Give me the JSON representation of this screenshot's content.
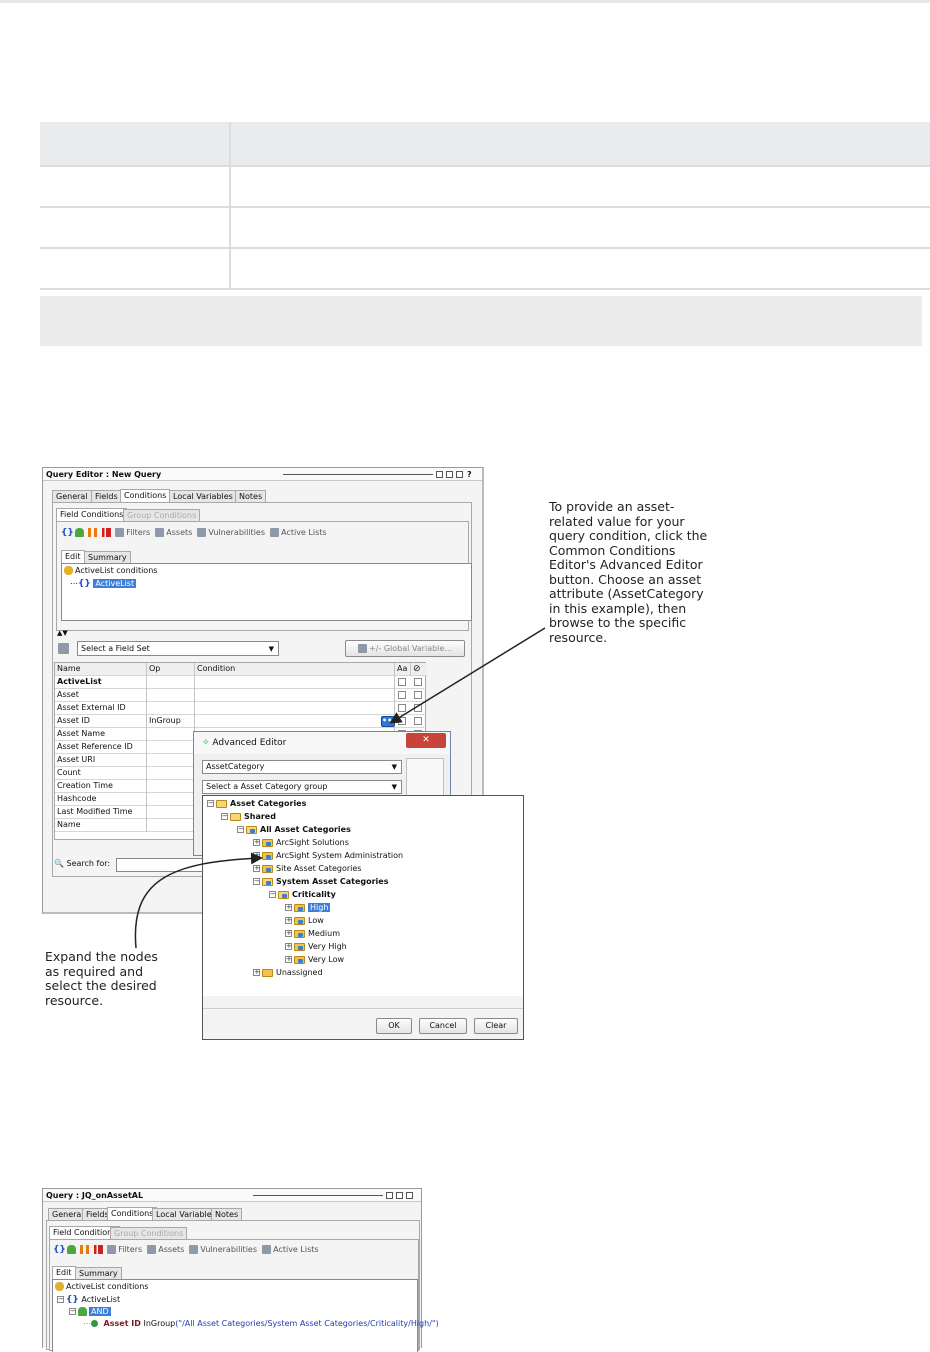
{
  "callouts": {
    "right": [
      "To provide an asset-",
      "related value for your",
      "query condition, click the",
      "Common Conditions",
      "Editor's Advanced Editor",
      "button. Choose an asset",
      "attribute (AssetCategory",
      "in this example), then",
      "browse to the specific",
      "resource."
    ],
    "left": [
      "Expand the nodes",
      "as required and",
      "select the desired",
      "resource."
    ]
  },
  "query_editor": {
    "title": "Query Editor : New Query",
    "tabs": [
      "General",
      "Fields",
      "Conditions",
      "Local Variables",
      "Notes"
    ],
    "subtabs": [
      "Field Conditions",
      "Group Conditions"
    ],
    "toolbar": {
      "filters": "Filters",
      "assets": "Assets",
      "vulnerabilities": "Vulnerabilities",
      "active_lists": "Active Lists"
    },
    "edit_tabs": [
      "Edit",
      "Summary"
    ],
    "tree": {
      "root": "ActiveList conditions",
      "child": "ActiveList"
    },
    "field_set_select": "Select a Field Set",
    "global_variable_button": "+/- Global Variable...",
    "grid_headers": {
      "name": "Name",
      "op": "Op",
      "condition": "Condition",
      "aa": "Aa"
    },
    "grid_rows": [
      {
        "name": "ActiveList",
        "op": "",
        "bold": true
      },
      {
        "name": "Asset",
        "op": ""
      },
      {
        "name": "Asset External ID",
        "op": ""
      },
      {
        "name": "Asset ID",
        "op": "InGroup"
      },
      {
        "name": "Asset Name",
        "op": ""
      },
      {
        "name": "Asset Reference ID",
        "op": ""
      },
      {
        "name": "Asset URI",
        "op": ""
      },
      {
        "name": "Count",
        "op": ""
      },
      {
        "name": "Creation Time",
        "op": ""
      },
      {
        "name": "Hashcode",
        "op": ""
      },
      {
        "name": "Last Modified Time",
        "op": ""
      },
      {
        "name": "Name",
        "op": ""
      }
    ],
    "search_label": "Search for:"
  },
  "advanced_editor": {
    "title": "Advanced Editor",
    "attribute_select": "AssetCategory",
    "group_select": "Select a Asset Category group",
    "tree": [
      {
        "label": "Asset Categories",
        "bold": true,
        "level": 0
      },
      {
        "label": "Shared",
        "bold": true,
        "level": 1
      },
      {
        "label": "All Asset Categories",
        "bold": true,
        "level": 2
      },
      {
        "label": "ArcSight Solutions",
        "level": 3
      },
      {
        "label": "ArcSight System Administration",
        "level": 3
      },
      {
        "label": "Site Asset Categories",
        "level": 3
      },
      {
        "label": "System Asset Categories",
        "bold": true,
        "level": 3
      },
      {
        "label": "Criticality",
        "bold": true,
        "level": 4
      },
      {
        "label": "High",
        "level": 5,
        "selected": true
      },
      {
        "label": "Low",
        "level": 5
      },
      {
        "label": "Medium",
        "level": 5
      },
      {
        "label": "Very High",
        "level": 5
      },
      {
        "label": "Very Low",
        "level": 5
      },
      {
        "label": "Unassigned",
        "level": 3
      }
    ],
    "buttons": {
      "ok": "OK",
      "cancel": "Cancel",
      "clear": "Clear"
    }
  },
  "query_window_2": {
    "title": "Query : JQ_onAssetAL",
    "tabs": [
      "General",
      "Fields",
      "Conditions",
      "Local Variables",
      "Notes"
    ],
    "subtabs": [
      "Field Conditions",
      "Group Conditions"
    ],
    "toolbar": {
      "filters": "Filters",
      "assets": "Assets",
      "vulnerabilities": "Vulnerabilities",
      "active_lists": "Active Lists"
    },
    "edit_tabs": [
      "Edit",
      "Summary"
    ],
    "tree": {
      "root": "ActiveList conditions",
      "child": "ActiveList",
      "and": "AND",
      "field": "Asset ID",
      "op": "InGroup",
      "value": "(\"/All Asset Categories/System Asset Categories/Criticality/High/\")"
    }
  }
}
